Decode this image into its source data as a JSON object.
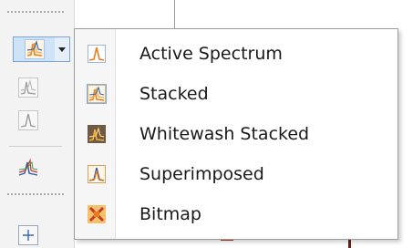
{
  "menu": {
    "items": [
      {
        "label": "Active Spectrum",
        "icon": "single-peak-icon"
      },
      {
        "label": "Stacked",
        "icon": "stacked-icon",
        "checked": true
      },
      {
        "label": "Whitewash Stacked",
        "icon": "whitewash-stacked-icon"
      },
      {
        "label": "Superimposed",
        "icon": "superimposed-icon"
      },
      {
        "label": "Bitmap",
        "icon": "bitmap-icon"
      }
    ]
  },
  "colors": {
    "accent": "#7aa7d8",
    "peak_orange": "#e87b1c",
    "peak_blue": "#2a5aa8",
    "bitmap_red": "#c0392b"
  }
}
